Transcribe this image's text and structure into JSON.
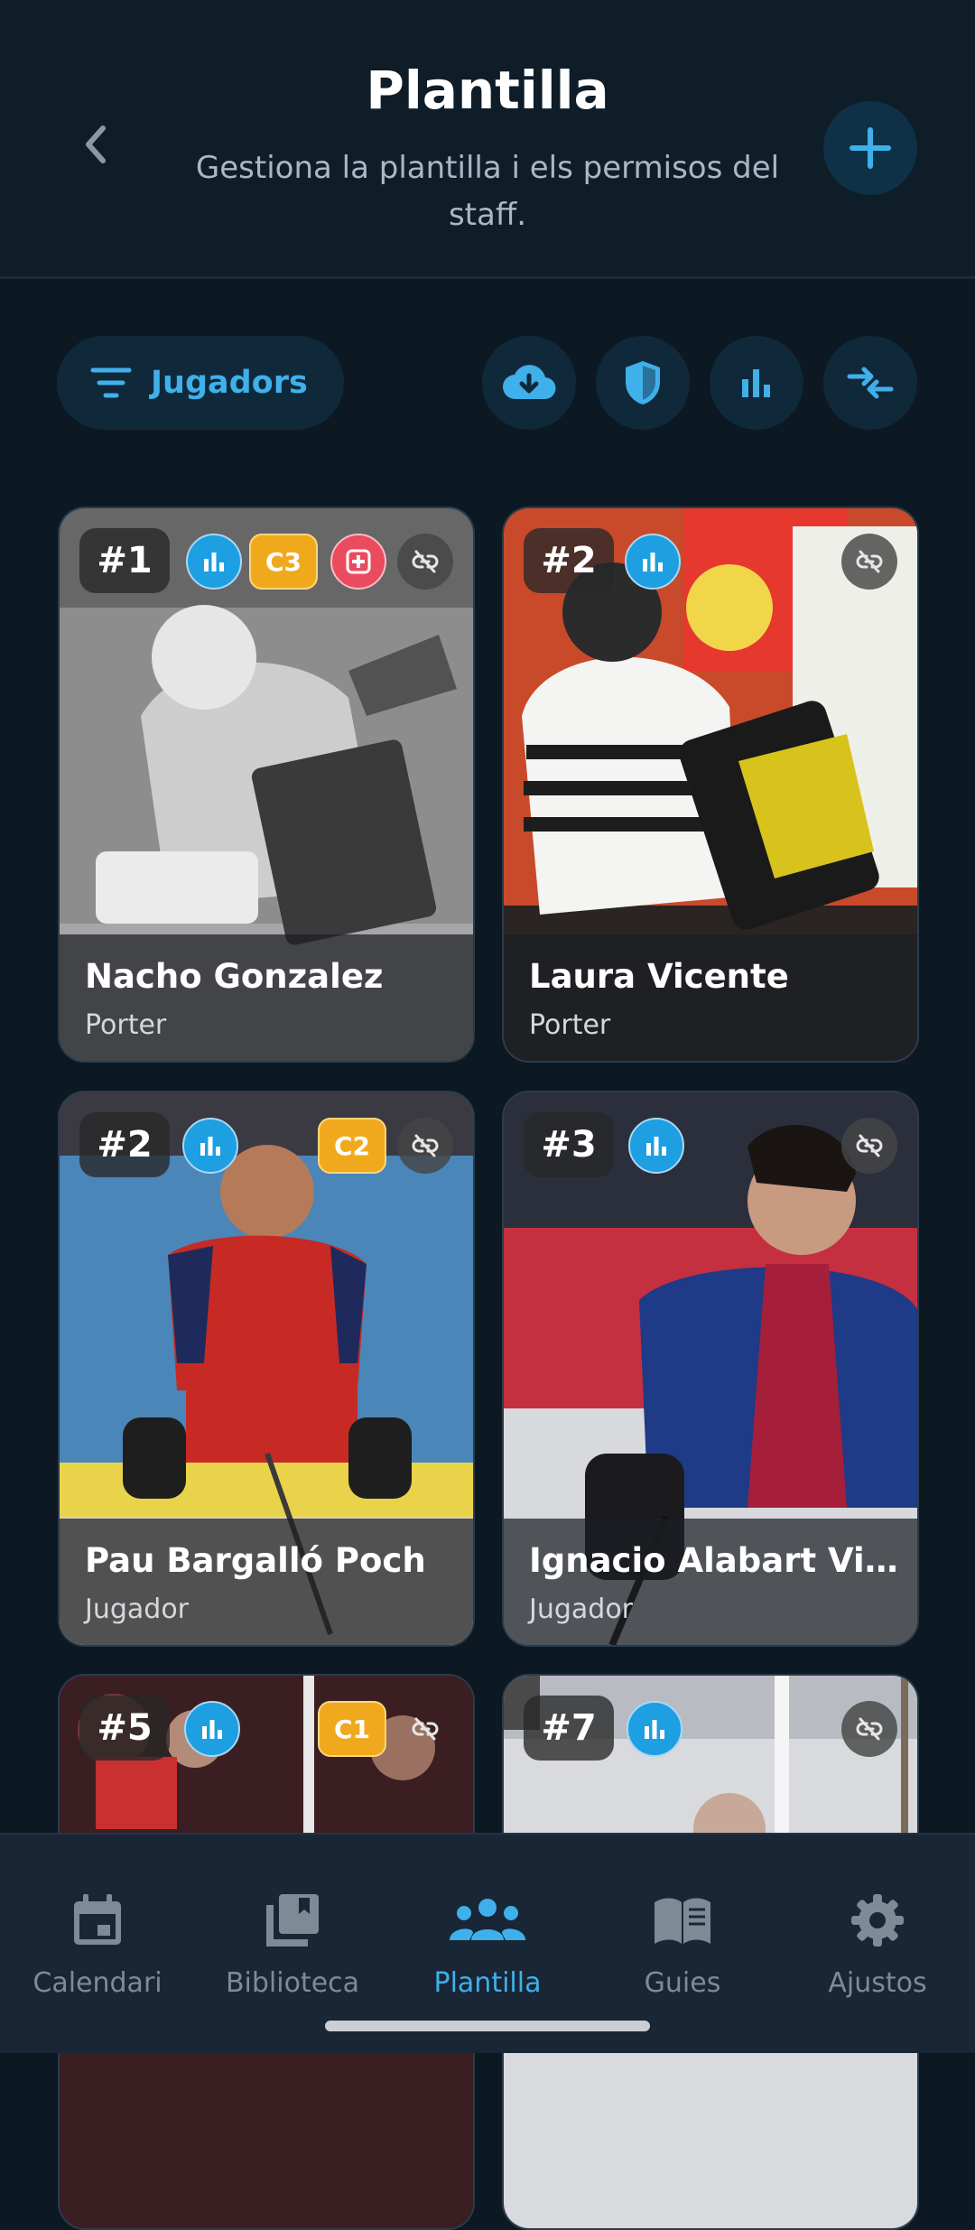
{
  "header": {
    "title": "Plantilla",
    "subtitle": "Gestiona la plantilla i els permisos del staff.",
    "back_icon": "chevron-left-icon",
    "add_icon": "plus-icon"
  },
  "toolbar": {
    "filter_label": "Jugadors",
    "filter_icon": "filter-lines-icon",
    "actions": [
      "cloud-download-icon",
      "shield-icon",
      "bar-chart-icon",
      "compress-arrows-icon"
    ]
  },
  "players": [
    {
      "number": "#1",
      "name": "Nacho Gonzalez",
      "role": "Porter",
      "captain": "C3",
      "medical": true,
      "grayscale": true
    },
    {
      "number": "#2",
      "name": "Laura Vicente",
      "role": "Porter",
      "captain": "",
      "medical": false,
      "grayscale": false
    },
    {
      "number": "#2",
      "name": "Pau Bargalló Poch",
      "role": "Jugador",
      "captain": "C2",
      "medical": false,
      "grayscale": false
    },
    {
      "number": "#3",
      "name": "Ignacio Alabart Vi…",
      "role": "Jugador",
      "captain": "",
      "medical": false,
      "grayscale": false
    },
    {
      "number": "#5",
      "name": "",
      "role": "",
      "captain": "C1",
      "medical": false,
      "grayscale": false
    },
    {
      "number": "#7",
      "name": "",
      "role": "",
      "captain": "",
      "medical": false,
      "grayscale": false
    }
  ],
  "nav": {
    "items": [
      {
        "label": "Calendari",
        "icon": "calendar-icon"
      },
      {
        "label": "Biblioteca",
        "icon": "library-icon"
      },
      {
        "label": "Plantilla",
        "icon": "team-icon"
      },
      {
        "label": "Guies",
        "icon": "book-icon"
      },
      {
        "label": "Ajustos",
        "icon": "gear-icon"
      }
    ],
    "active": "Plantilla"
  },
  "colors": {
    "accent": "#3fb0ea",
    "background": "#0c1822",
    "captain_badge": "#f0a91c",
    "medical_badge": "#ea4b5f"
  }
}
